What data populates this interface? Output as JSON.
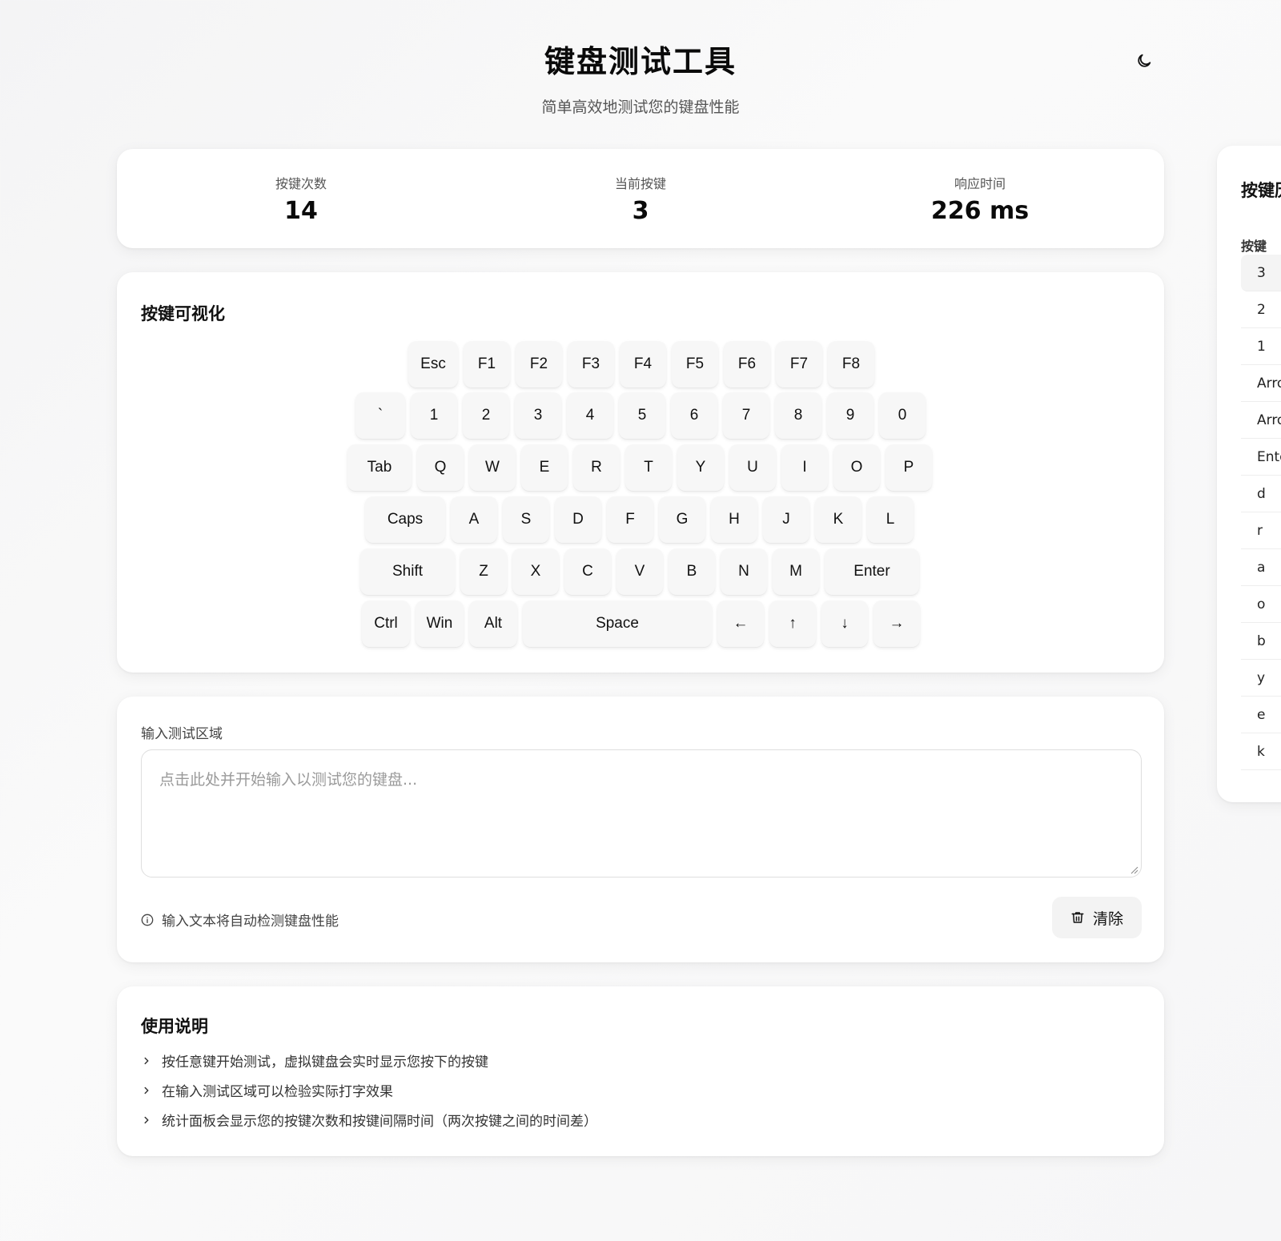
{
  "header": {
    "title": "键盘测试工具",
    "subtitle": "简单高效地测试您的键盘性能",
    "theme_icon": "moon-icon"
  },
  "stats": [
    {
      "label": "按键次数",
      "value": "14"
    },
    {
      "label": "当前按键",
      "value": "3"
    },
    {
      "label": "响应时间",
      "value": "226 ms"
    }
  ],
  "visualization": {
    "title": "按键可视化",
    "rows": [
      [
        "Esc",
        "F1",
        "F2",
        "F3",
        "F4",
        "F5",
        "F6",
        "F7",
        "F8"
      ],
      [
        "`",
        "1",
        "2",
        "3",
        "4",
        "5",
        "6",
        "7",
        "8",
        "9",
        "0"
      ],
      [
        "Tab",
        "Q",
        "W",
        "E",
        "R",
        "T",
        "Y",
        "U",
        "I",
        "O",
        "P"
      ],
      [
        "Caps",
        "A",
        "S",
        "D",
        "F",
        "G",
        "H",
        "J",
        "K",
        "L"
      ],
      [
        "Shift",
        "Z",
        "X",
        "C",
        "V",
        "B",
        "N",
        "M",
        "Enter"
      ],
      [
        "Ctrl",
        "Win",
        "Alt",
        "Space",
        "←",
        "↑",
        "↓",
        "→"
      ]
    ]
  },
  "input_area": {
    "label": "输入测试区域",
    "placeholder": "点击此处并开始输入以测试您的键盘...",
    "value": "",
    "hint": "输入文本将自动检测键盘性能",
    "clear_label": "清除"
  },
  "usage": {
    "title": "使用说明",
    "items": [
      "按任意键开始测试，虚拟键盘会实时显示您按下的按键",
      "在输入测试区域可以检验实际打字效果",
      "统计面板会显示您的按键次数和按键间隔时间（两次按键之间的时间差）"
    ]
  },
  "history": {
    "title": "按键历",
    "column": "按键",
    "keys": [
      "3",
      "2",
      "1",
      "Arro",
      "Arro",
      "Ente",
      "d",
      "r",
      "a",
      "o",
      "b",
      "y",
      "e",
      "k"
    ]
  }
}
